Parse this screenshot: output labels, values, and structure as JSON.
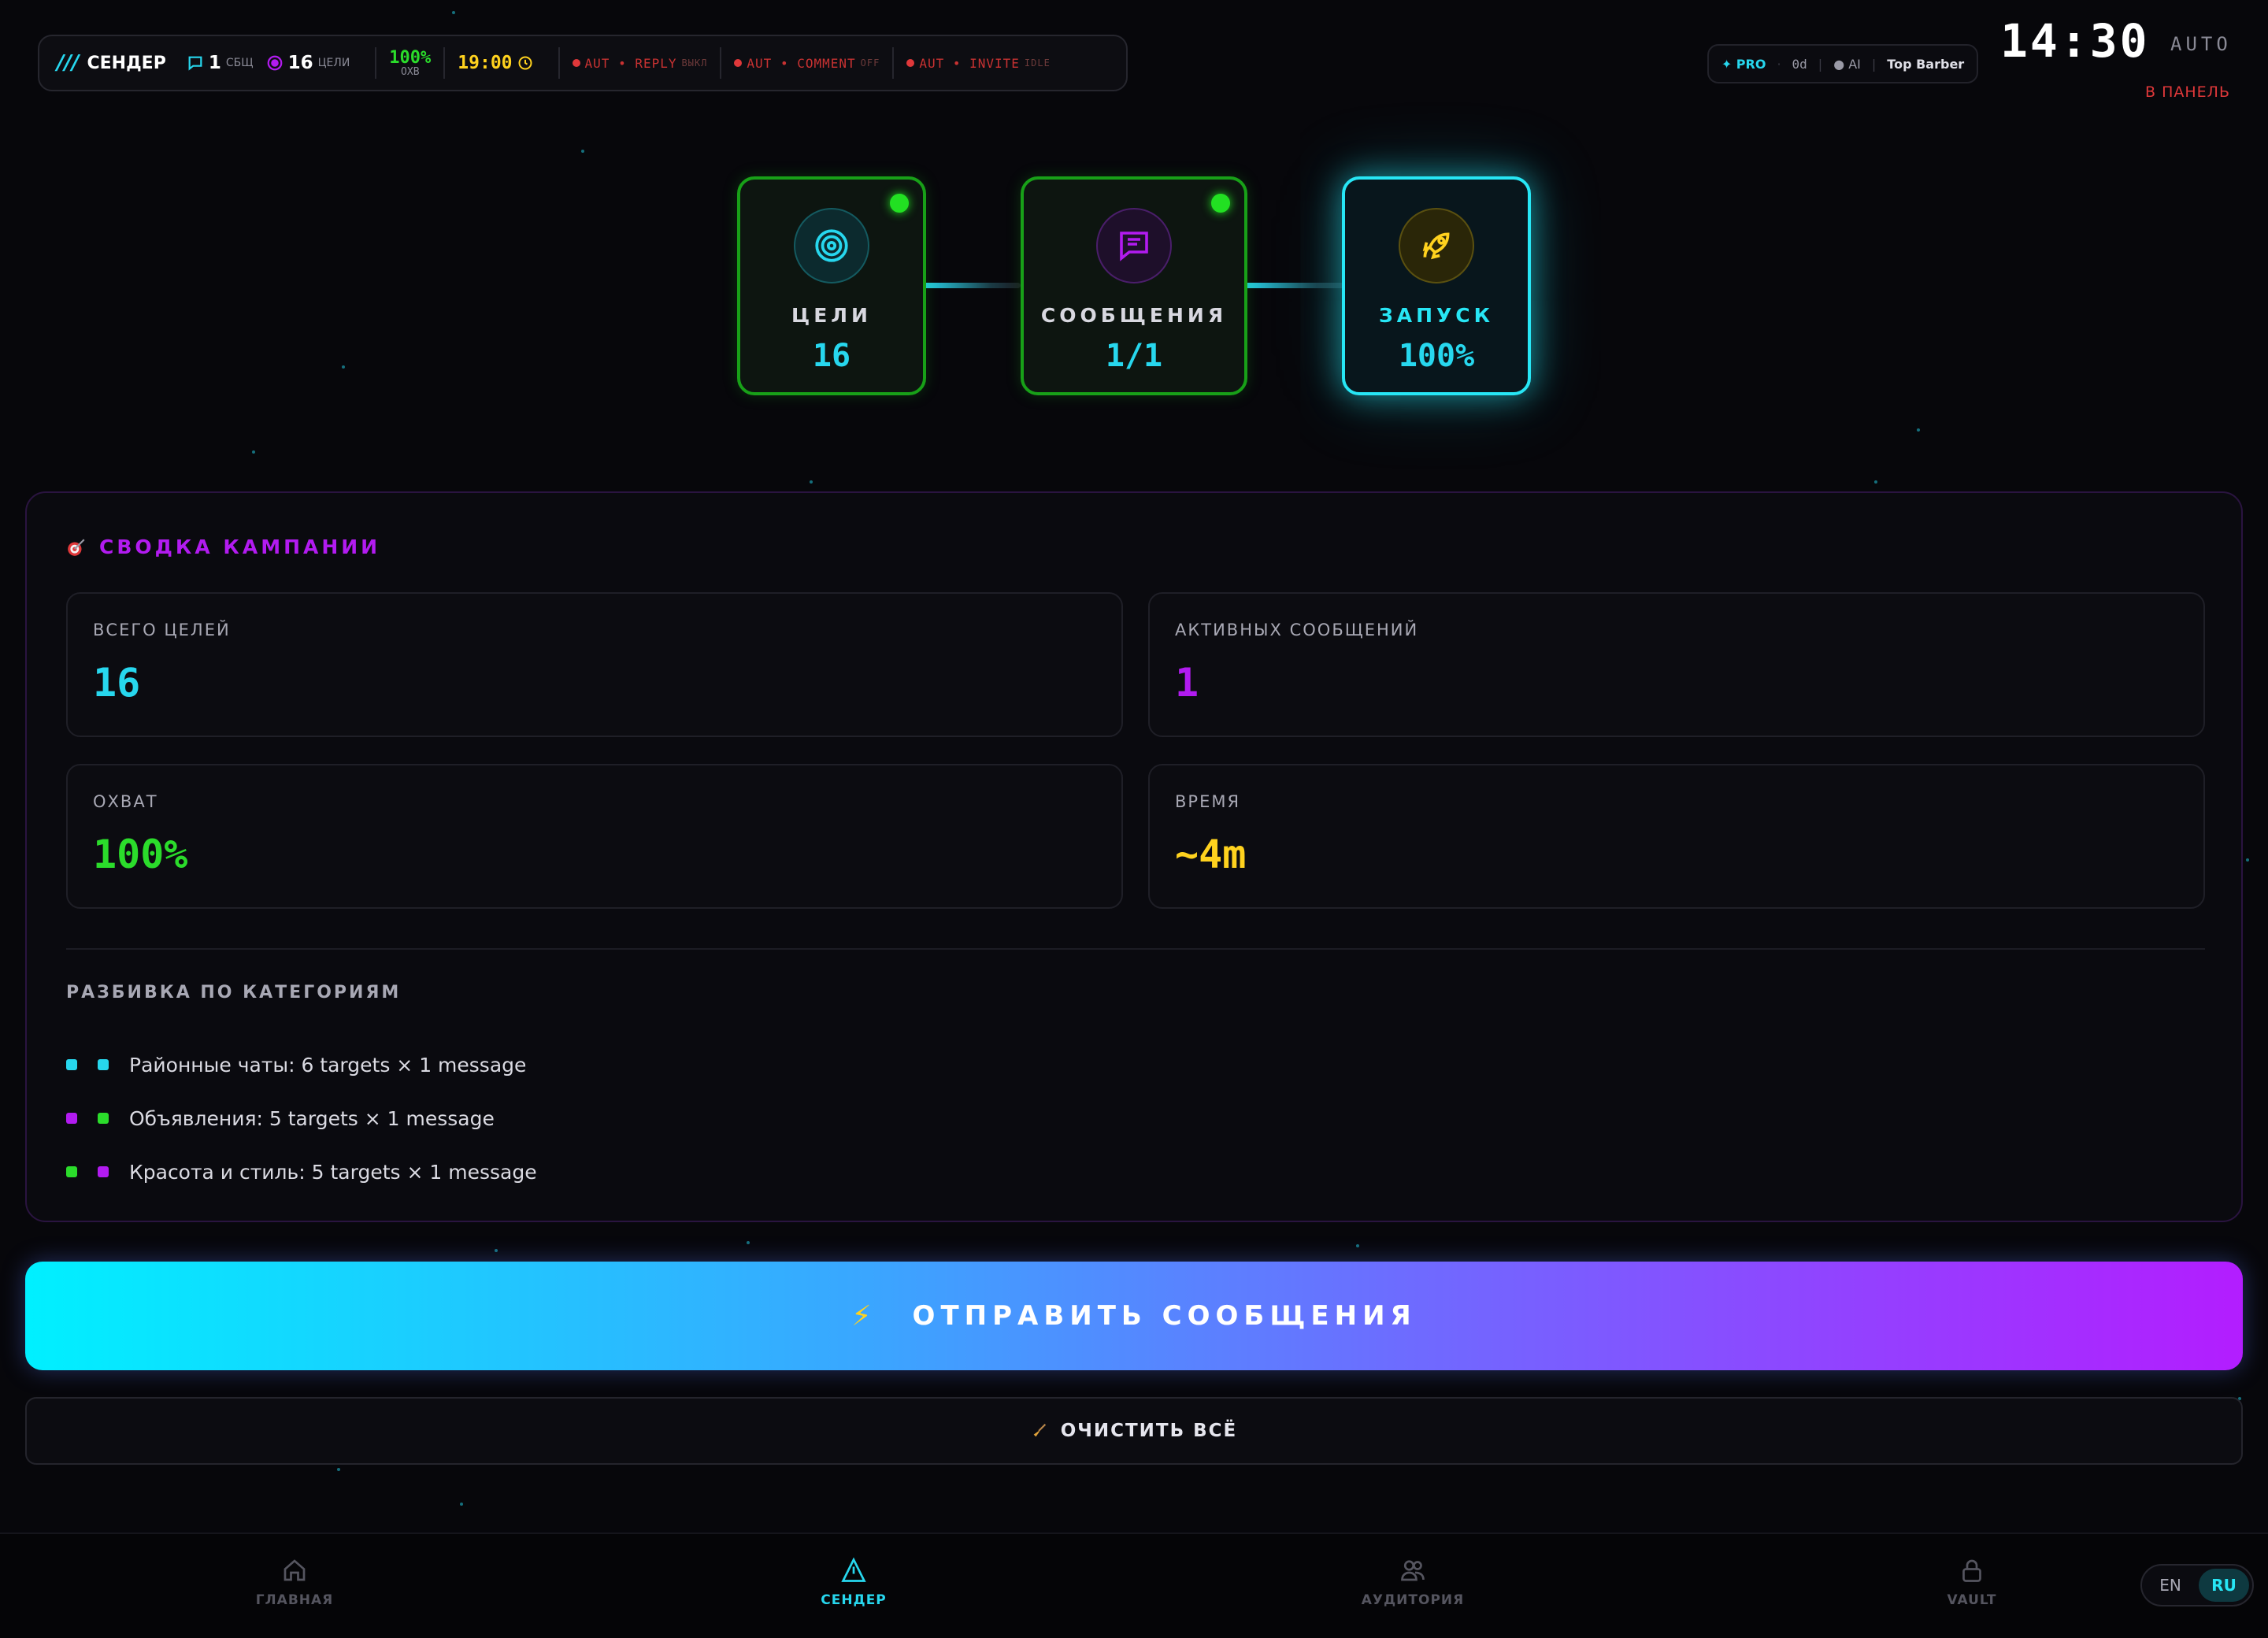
{
  "statusbar": {
    "logo": "///",
    "app_name": "СЕНДЕР",
    "messages_count": "1",
    "messages_label": "СБЩ",
    "targets_count": "16",
    "targets_label": "ЦЕЛИ",
    "reach_value": "100%",
    "reach_label": "ОХВ",
    "time": "19:00",
    "auto_reply": {
      "label": "AUT • REPLY",
      "state": "ВЫКЛ"
    },
    "auto_comment": {
      "label": "AUT • COMMENT",
      "state": "OFF"
    },
    "auto_invite": {
      "label": "AUT • INVITE",
      "state": "IDLE"
    }
  },
  "pro_bar": {
    "pro": "✦ PRO",
    "days": "0d",
    "ai": "● AI",
    "account": "Top Barber"
  },
  "clock": {
    "time": "14:30",
    "mode": "AUTO",
    "panel_link": "В ПАНЕЛЬ"
  },
  "steps": [
    {
      "label": "ЦЕЛИ",
      "value": "16",
      "icon": "target-icon",
      "status": "done"
    },
    {
      "label": "СООБЩЕНИЯ",
      "value": "1/1",
      "icon": "message-icon",
      "status": "done"
    },
    {
      "label": "ЗАПУСК",
      "value": "100%",
      "icon": "rocket-icon",
      "status": "active"
    }
  ],
  "summary": {
    "title": "СВОДКА КАМПАНИИ",
    "title_icon": "dart-icon",
    "cards": [
      {
        "label": "ВСЕГО ЦЕЛЕЙ",
        "value": "16",
        "color": "#27d7ee"
      },
      {
        "label": "АКТИВНЫХ СООБЩЕНИЙ",
        "value": "1",
        "color": "#b21bf0"
      },
      {
        "label": "ОХВАТ",
        "value": "100%",
        "color": "#2bdc2b"
      },
      {
        "label": "ВРЕМЯ",
        "value": "~4m",
        "color": "#ffd21e"
      }
    ],
    "breakdown_title": "РАЗБИВКА ПО КАТЕГОРИЯМ",
    "breakdown": [
      {
        "text": "Районные чаты: 6 targets × 1 message",
        "colors": [
          "#27d7ee",
          "#27d7ee"
        ]
      },
      {
        "text": "Объявления: 5 targets × 1 message",
        "colors": [
          "#b21bf0",
          "#2bdc2b"
        ]
      },
      {
        "text": "Красота и стиль: 5 targets × 1 message",
        "colors": [
          "#2bdc2b",
          "#b21bf0"
        ]
      }
    ]
  },
  "actions": {
    "send_label": "ОТПРАВИТЬ СООБЩЕНИЯ",
    "send_icon": "⚡",
    "clear_label": "ОЧИСТИТЬ ВСЁ",
    "clear_icon": "broom-icon"
  },
  "nav": [
    {
      "label": "ГЛАВНАЯ",
      "icon": "home-icon",
      "active": false
    },
    {
      "label": "СЕНДЕР",
      "icon": "send-icon",
      "active": true
    },
    {
      "label": "АУДИТОРИЯ",
      "icon": "users-icon",
      "active": false
    },
    {
      "label": "VAULT",
      "icon": "lock-icon",
      "active": false
    }
  ],
  "language": {
    "options": [
      "EN",
      "RU"
    ],
    "selected": "RU"
  }
}
